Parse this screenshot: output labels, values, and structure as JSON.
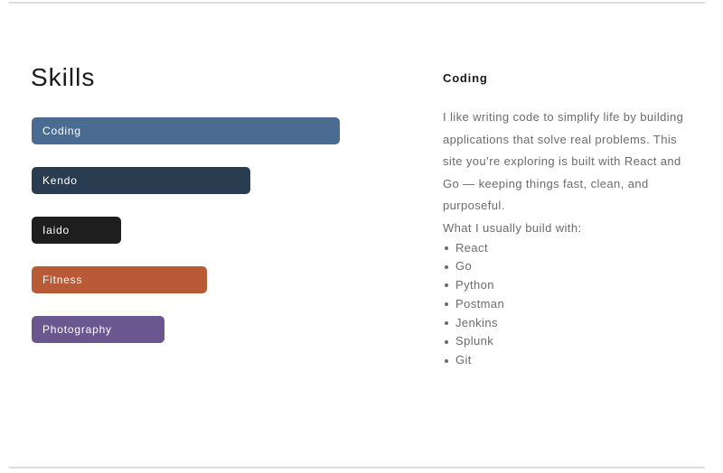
{
  "page": {
    "title": "Skills"
  },
  "skills": [
    {
      "label": "Coding",
      "level": 1.0,
      "color": "#4a6c93"
    },
    {
      "label": "Kendo",
      "level": 0.71,
      "color": "#2a3c50"
    },
    {
      "label": "Iaido",
      "level": 0.29,
      "color": "#1e1e1e"
    },
    {
      "label": "Fitness",
      "level": 0.57,
      "color": "#b85a35"
    },
    {
      "label": "Photography",
      "level": 0.43,
      "color": "#6b5790"
    }
  ],
  "detail": {
    "title": "Coding",
    "description": "I like writing code to simplify life by building applications that solve real problems. This site you’re exploring is built with React and Go — keeping things fast, clean, and purposeful.",
    "subheading": "What I usually build with:",
    "tools": [
      "React",
      "Go",
      "Python",
      "Postman",
      "Jenkins",
      "Splunk",
      "Git"
    ]
  }
}
